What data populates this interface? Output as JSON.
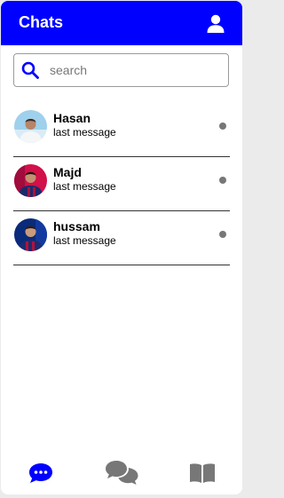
{
  "header": {
    "title": "Chats",
    "icon": "user-icon"
  },
  "search": {
    "placeholder": "search",
    "value": "",
    "icon": "search-icon"
  },
  "chats": [
    {
      "name": "Hasan",
      "last_message": "last message",
      "avatar": "avatar-hasan"
    },
    {
      "name": "Majd",
      "last_message": "last message",
      "avatar": "avatar-majd"
    },
    {
      "name": "hussam",
      "last_message": "last message",
      "avatar": "avatar-hussam"
    }
  ],
  "bottom_nav": [
    {
      "name": "chats",
      "icon": "chat-bubble-icon",
      "active": true
    },
    {
      "name": "conversations",
      "icon": "comments-icon",
      "active": false
    },
    {
      "name": "stories",
      "icon": "book-icon",
      "active": false
    }
  ],
  "colors": {
    "accent": "#0000ff",
    "inactive": "#777777",
    "background": "#ffffff"
  }
}
